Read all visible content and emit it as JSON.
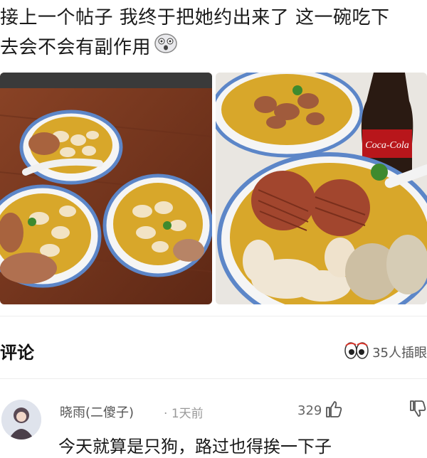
{
  "post": {
    "text_line1": "接上一个帖子 我终于把她约出来了 这一碗吃下",
    "text_line2": "去会不会有副作用"
  },
  "photos": [
    {
      "alt": "three bowls of noodle soup with beans and tripe on a wooden table"
    },
    {
      "alt": "bowls of noodle soup with offal next to a bottle of cola"
    }
  ],
  "bottle_label": "Coca-Cola",
  "comments_section": {
    "title": "评论",
    "watchers_count": "35人插眼"
  },
  "comment": {
    "author": "晓雨(二傻子)",
    "time": "1天前",
    "likes": "329",
    "text": "今天就算是只狗，路过也得挨一下子"
  },
  "colors": {
    "broth": "#d8a72a",
    "bowl_rim": "#5c86c8",
    "table": "#7a3a22"
  }
}
